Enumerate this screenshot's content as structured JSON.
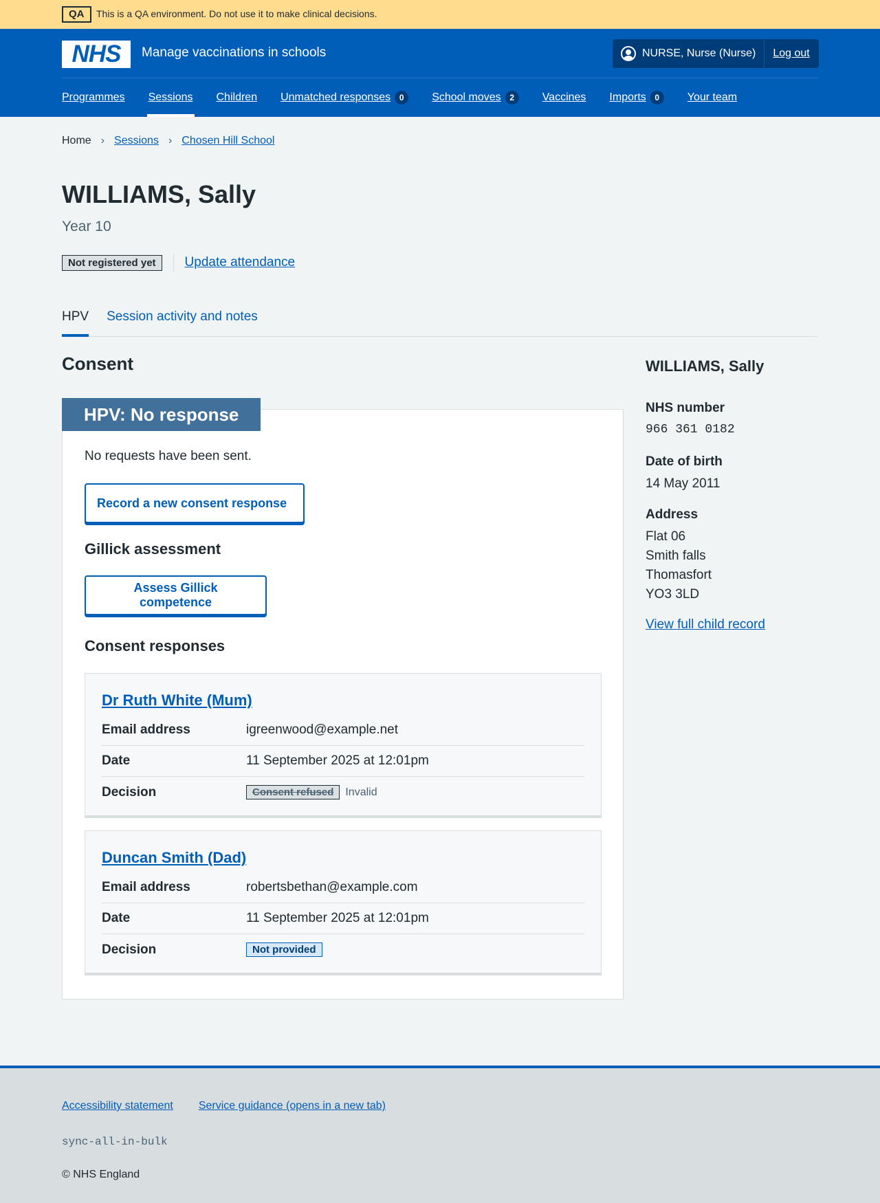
{
  "qa_banner": {
    "tag": "QA",
    "text": "This is a QA environment. Do not use it to make clinical decisions."
  },
  "header": {
    "logo": "NHS",
    "service_name": "Manage vaccinations in schools",
    "user": "NURSE, Nurse (Nurse)",
    "logout": "Log out",
    "nav": [
      {
        "label": "Programmes"
      },
      {
        "label": "Sessions",
        "active": true
      },
      {
        "label": "Children"
      },
      {
        "label": "Unmatched responses",
        "count": "0"
      },
      {
        "label": "School moves",
        "count": "2"
      },
      {
        "label": "Vaccines"
      },
      {
        "label": "Imports",
        "count": "0"
      },
      {
        "label": "Your team"
      }
    ]
  },
  "breadcrumb": [
    "Home",
    "Sessions",
    "Chosen Hill School"
  ],
  "patient": {
    "name": "WILLIAMS, Sally",
    "year": "Year 10",
    "registration_status": "Not registered yet",
    "update_attendance": "Update attendance"
  },
  "tabs": [
    "HPV",
    "Session activity and notes"
  ],
  "consent": {
    "heading": "Consent",
    "card_heading": "HPV: No response",
    "no_requests": "No requests have been sent.",
    "record_button": "Record a new consent response",
    "gillick_heading": "Gillick assessment",
    "gillick_button": "Assess Gillick competence",
    "responses_heading": "Consent responses",
    "responses": [
      {
        "name": "Dr Ruth White (Mum)",
        "email_label": "Email address",
        "email": "igreenwood@example.net",
        "date_label": "Date",
        "date": "11 September 2025 at 12:01pm",
        "decision_label": "Decision",
        "decision": "Consent refused",
        "decision_note": "Invalid"
      },
      {
        "name": "Duncan Smith (Dad)",
        "email_label": "Email address",
        "email": "robertsbethan@example.com",
        "date_label": "Date",
        "date": "11 September 2025 at 12:01pm",
        "decision_label": "Decision",
        "decision": "Not provided"
      }
    ]
  },
  "sidebar": {
    "name": "WILLIAMS, Sally",
    "nhs_label": "NHS number",
    "nhs_number": "966 361 0182",
    "dob_label": "Date of birth",
    "dob": "14 May 2011",
    "address_label": "Address",
    "address": [
      "Flat 06",
      "Smith falls",
      "Thomasfort",
      "YO3 3LD"
    ],
    "full_record_link": "View full child record"
  },
  "footer": {
    "links": [
      "Accessibility statement",
      "Service guidance (opens in a new tab)"
    ],
    "code": "sync-all-in-bulk",
    "copyright": "© NHS England"
  },
  "colors": {
    "brand": "#005eb8",
    "qa_banner": "#ffdc8e",
    "card_heading": "#41709b"
  }
}
